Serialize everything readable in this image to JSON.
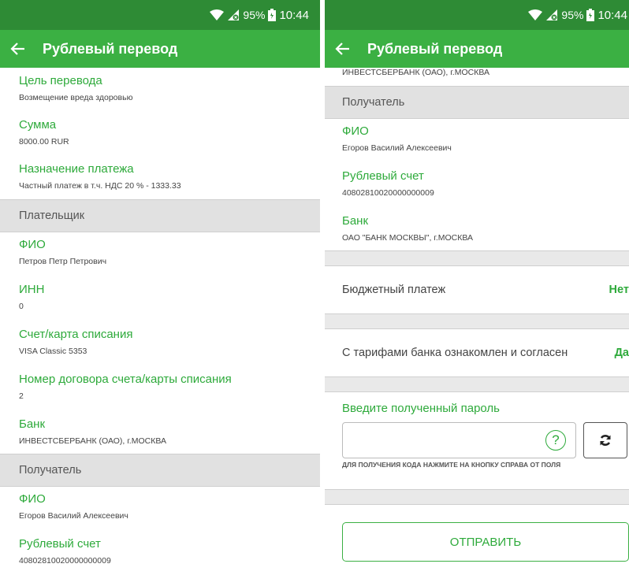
{
  "status": {
    "battery": "95%",
    "time": "10:44"
  },
  "appbar": {
    "title": "Рублевый перевод"
  },
  "left": {
    "fields_top": [
      {
        "label": "Цель перевода",
        "value": "Возмещение вреда здоровью"
      },
      {
        "label": "Сумма",
        "value": "8000.00 RUR"
      },
      {
        "label": "Назначение платежа",
        "value": "Частный платеж в т.ч. НДС 20 % - 1333.33"
      }
    ],
    "payer_section": "Плательщик",
    "payer_fields": [
      {
        "label": "ФИО",
        "value": "Петров Петр Петрович"
      },
      {
        "label": "ИНН",
        "value": "0"
      },
      {
        "label": "Счет/карта списания",
        "value": "VISA Classic 5353"
      },
      {
        "label": "Номер договора счета/карты списания",
        "value": "2"
      },
      {
        "label": "Банк",
        "value": "ИНВЕСТСБЕРБАНК (ОАО), г.МОСКВА"
      }
    ],
    "recipient_section": "Получатель",
    "recipient_fields": [
      {
        "label": "ФИО",
        "value": "Егоров Василий Алексеевич"
      },
      {
        "label": "Рублевый счет",
        "value": "40802810020000000009"
      }
    ]
  },
  "right": {
    "partial_value": "ИНВЕСТСБЕРБАНК (ОАО), г.МОСКВА",
    "recipient_section": "Получатель",
    "recipient_fields": [
      {
        "label": "ФИО",
        "value": "Егоров Василий Алексеевич"
      },
      {
        "label": "Рублевый счет",
        "value": "40802810020000000009"
      },
      {
        "label": "Банк",
        "value": "ОАО \"БАНК МОСКВЫ\", г.МОСКВА"
      }
    ],
    "budget_row": {
      "label": "Бюджетный платеж",
      "value": "Нет"
    },
    "tariff_row": {
      "label": "С тарифами банка ознакомлен и согласен",
      "value": "Да"
    },
    "password": {
      "label": "Введите полученный пароль",
      "value": "",
      "placeholder": "",
      "help": "?",
      "hint": "ДЛЯ ПОЛУЧЕНИЯ КОДА НАЖМИТЕ НА КНОПКУ СПРАВА ОТ ПОЛЯ"
    },
    "send_label": "ОТПРАВИТЬ"
  },
  "colors": {
    "statusbar": "#2e8b35",
    "appbar": "#3bb043",
    "accent": "#2eaa3b"
  },
  "icons": [
    "wifi-icon",
    "no-sim-icon",
    "battery-icon",
    "back-arrow-icon",
    "help-icon",
    "refresh-icon"
  ]
}
